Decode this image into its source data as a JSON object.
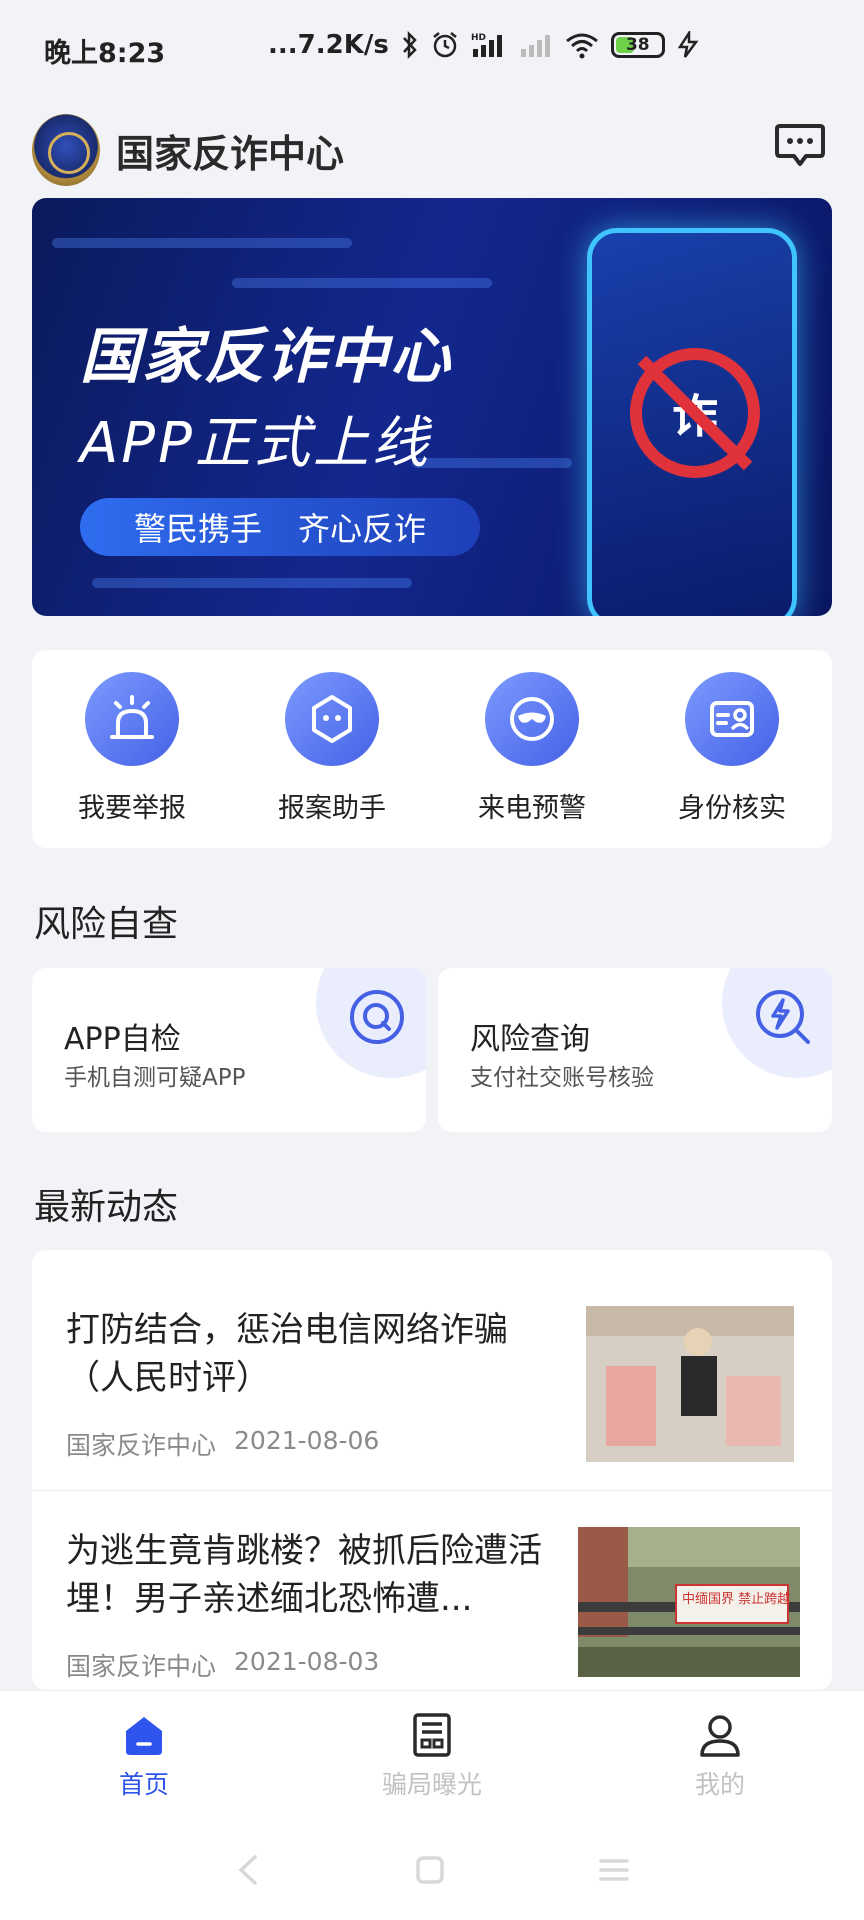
{
  "status_bar": {
    "time": "晚上8:23",
    "net_speed": "...7.2K/s",
    "battery_level": "38",
    "battery_fraction": 0.38
  },
  "header": {
    "title": "国家反诈中心"
  },
  "banner": {
    "title": "国家反诈中心",
    "subtitle": "APP正式上线",
    "slogan_left": "警民携手",
    "slogan_right": "齐心反诈",
    "sign_char": "诈"
  },
  "quick_actions": [
    {
      "label": "我要举报",
      "icon": "alarm-light-icon"
    },
    {
      "label": "报案助手",
      "icon": "assistant-face-icon"
    },
    {
      "label": "来电预警",
      "icon": "mask-icon"
    },
    {
      "label": "身份核实",
      "icon": "id-card-icon"
    }
  ],
  "risk_section": {
    "title": "风险自查",
    "cards": [
      {
        "title": "APP自检",
        "subtitle": "手机自测可疑APP",
        "icon": "scan-icon"
      },
      {
        "title": "风险查询",
        "subtitle": "支付社交账号核验",
        "icon": "lightning-search-icon"
      }
    ]
  },
  "news_section": {
    "title": "最新动态",
    "items": [
      {
        "title": "打防结合，惩治电信网络诈骗（人民时评）",
        "source": "国家反诈中心",
        "date": "2021-08-06"
      },
      {
        "title": "为逃生竟肯跳楼？被抓后险遭活埋！男子亲述缅北恐怖遭...",
        "source": "国家反诈中心",
        "date": "2021-08-03",
        "sign_text": "中缅国界 禁止跨越"
      }
    ]
  },
  "tabbar": {
    "tabs": [
      {
        "label": "首页",
        "active": true
      },
      {
        "label": "骗局曝光",
        "active": false
      },
      {
        "label": "我的",
        "active": false
      }
    ]
  },
  "colors": {
    "accent": "#2f54eb",
    "icon_gradient_start": "#7c9bff",
    "icon_gradient_end": "#4461e6",
    "banner_bg": "#13278e",
    "warning_red": "#e0323a"
  }
}
